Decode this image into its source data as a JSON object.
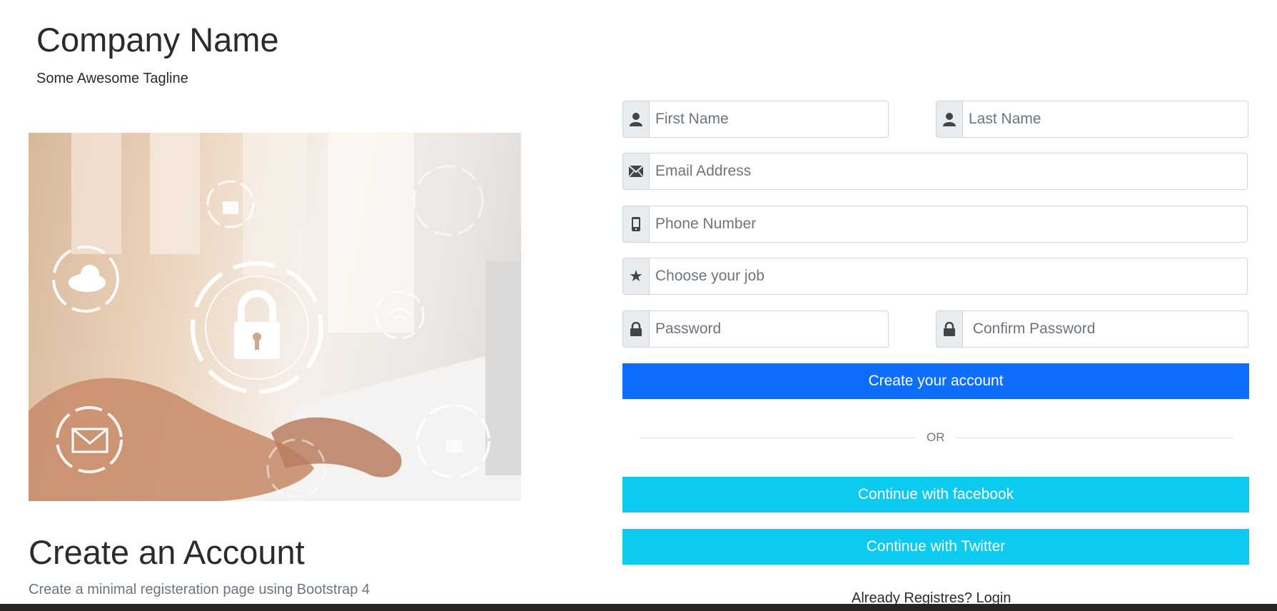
{
  "header": {
    "company_name": "Company Name",
    "tagline": "Some Awesome Tagline"
  },
  "intro": {
    "title": "Create an Account",
    "subtitle": "Create a minimal registeration page using Bootstrap 4"
  },
  "form": {
    "first_name": {
      "placeholder": "First Name",
      "icon": "user-icon"
    },
    "last_name": {
      "placeholder": "Last Name",
      "icon": "user-icon"
    },
    "email": {
      "placeholder": "Email Address",
      "icon": "envelope-icon"
    },
    "phone": {
      "placeholder": "Phone Number",
      "icon": "mobile-icon"
    },
    "job": {
      "placeholder": "Choose your job",
      "icon": "star-icon"
    },
    "password": {
      "placeholder": "Password",
      "icon": "lock-icon"
    },
    "confirm_password": {
      "placeholder": " Confirm Password",
      "icon": "lock-icon"
    },
    "submit_label": "Create your account"
  },
  "divider": {
    "text": "OR"
  },
  "social": {
    "facebook_label": "Continue with facebook",
    "twitter_label": "Continue with Twitter"
  },
  "footer": {
    "login_text": "Already Registres? Login"
  },
  "colors": {
    "primary": "#0d6efd",
    "info": "#0dcaf0",
    "addon_bg": "#e9ecef",
    "border": "#ced4da"
  }
}
